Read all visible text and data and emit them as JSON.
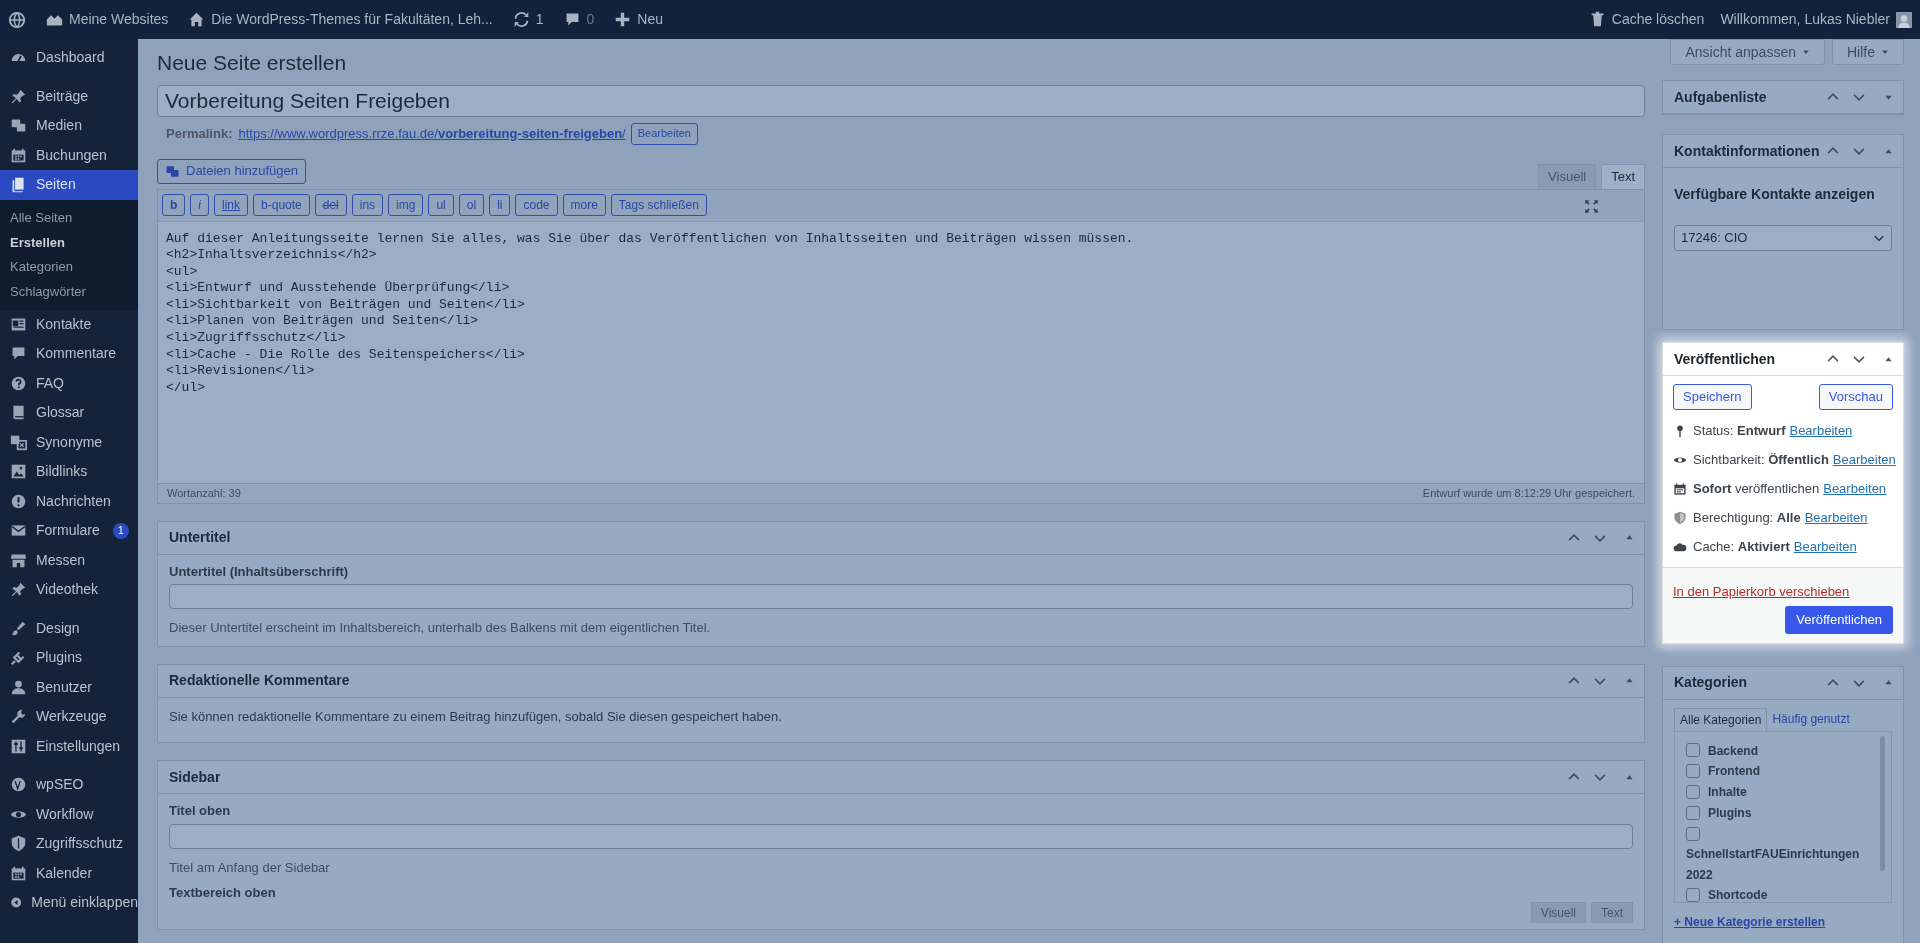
{
  "admin_bar": {
    "site_menu": "Meine Websites",
    "site_name": "Die WordPress-Themes für Fakultäten, Leh...",
    "updates": "1",
    "comments": "0",
    "new": "Neu",
    "cache": "Cache löschen",
    "greeting": "Willkommen, Lukas Niebler"
  },
  "sidebar": {
    "groups": [
      {
        "items": [
          {
            "label": "Dashboard",
            "selected": false
          }
        ]
      },
      {
        "items": [
          {
            "label": "Beiträge",
            "selected": false
          },
          {
            "label": "Medien",
            "selected": false
          },
          {
            "label": "Buchungen",
            "selected": false
          },
          {
            "label": "Seiten",
            "selected": true,
            "children": [
              {
                "label": "Alle Seiten",
                "selected": false
              },
              {
                "label": "Erstellen",
                "selected": true
              },
              {
                "label": "Kategorien",
                "selected": false
              },
              {
                "label": "Schlagwörter",
                "selected": false
              }
            ]
          },
          {
            "label": "Kontakte",
            "selected": false
          },
          {
            "label": "Kommentare",
            "selected": false
          },
          {
            "label": "FAQ",
            "selected": false
          },
          {
            "label": "Glossar",
            "selected": false
          },
          {
            "label": "Synonyme",
            "selected": false
          },
          {
            "label": "Bildlinks",
            "selected": false
          },
          {
            "label": "Nachrichten",
            "selected": false
          },
          {
            "label": "Formulare",
            "selected": false,
            "badge": "1"
          },
          {
            "label": "Messen",
            "selected": false
          },
          {
            "label": "Videothek",
            "selected": false
          }
        ]
      },
      {
        "items": [
          {
            "label": "Design",
            "selected": false
          },
          {
            "label": "Plugins",
            "selected": false
          },
          {
            "label": "Benutzer",
            "selected": false
          },
          {
            "label": "Werkzeuge",
            "selected": false
          },
          {
            "label": "Einstellungen",
            "selected": false
          }
        ]
      },
      {
        "items": [
          {
            "label": "wpSEO",
            "selected": false
          },
          {
            "label": "Workflow",
            "selected": false
          },
          {
            "label": "Zugriffsschutz",
            "selected": false
          },
          {
            "label": "Kalender",
            "selected": false
          },
          {
            "label": "Menü einklappen",
            "selected": false
          }
        ]
      }
    ]
  },
  "page_title": "Neue Seite erstellen",
  "screen_buttons": [
    "Ansicht anpassen",
    "Hilfe"
  ],
  "post_title": "Vorbereitung Seiten Freigeben",
  "permalink": {
    "label": "Permalink:",
    "base": "https://www.wordpress.rrze.fau.de/",
    "slug": "vorbereitung-seiten-freigeben",
    "trailing": "/",
    "edit": "Bearbeiten"
  },
  "media_button": "Dateien hinzufügen",
  "editor_tabs": [
    {
      "label": "Visuell",
      "selected": false
    },
    {
      "label": "Text",
      "selected": true
    }
  ],
  "quicktags": [
    "b",
    "i",
    "link",
    "b-quote",
    "del",
    "ins",
    "img",
    "ul",
    "ol",
    "li",
    "code",
    "more",
    "Tags schließen"
  ],
  "content_lines": [
    "Auf dieser Anleitungsseite lernen Sie alles, was Sie über das Veröffentlichen von Inhaltsseiten und Beiträgen wissen müssen.",
    "<h2>Inhaltsverzeichnis</h2>",
    "<ul>",
    "<li>Entwurf und Ausstehende Überprüfung</li>",
    "<li>Sichtbarkeit von Beiträgen und Seiten</li>",
    "<li>Planen von Beiträgen und Seiten</li>",
    "<li>Zugriffsschutz</li>",
    "<li>Cache - Die Rolle des Seitenspeichers</li>",
    "<li>Revisionen</li>",
    "</ul>"
  ],
  "word_count": "Wortanzahl: 39",
  "autosave": "Entwurf wurde um 8:12:29 Uhr gespeichert.",
  "main_boxes": [
    {
      "title": "Untertitel",
      "content": [
        {
          "kind": "label",
          "text": "Untertitel (Inhaltsüberschrift)"
        },
        {
          "kind": "input"
        },
        {
          "kind": "help",
          "text": "Dieser Untertitel erscheint im Inhaltsbereich, unterhalb des Balkens mit dem eigentlichen Titel."
        }
      ]
    },
    {
      "title": "Redaktionelle Kommentare",
      "content": [
        {
          "kind": "text",
          "text": "Sie können redaktionelle Kommentare zu einem Beitrag hinzufügen, sobald Sie diesen gespeichert haben."
        }
      ]
    },
    {
      "title": "Sidebar",
      "content": [
        {
          "kind": "label",
          "text": "Titel oben"
        },
        {
          "kind": "input"
        },
        {
          "kind": "help",
          "text": "Titel am Anfang der Sidebar"
        },
        {
          "kind": "label",
          "text": "Textbereich oben"
        },
        {
          "kind": "tabs",
          "tabs": [
            {
              "label": "Visuell",
              "selected": false
            },
            {
              "label": "Text",
              "selected": false
            }
          ]
        }
      ]
    }
  ],
  "side_boxes": [
    {
      "kind": "plain",
      "title": "Aufgabenliste",
      "expanded": false
    },
    {
      "kind": "contacts",
      "title": "Kontaktinformationen",
      "expanded": true,
      "heading": "Verfügbare Kontakte anzeigen",
      "select": "17246: CIO"
    },
    {
      "kind": "publish",
      "title": "Veröffentlichen",
      "expanded": true,
      "save": "Speichern",
      "preview": "Vorschau",
      "rows": [
        {
          "text": "Status: **Entwurf**",
          "edit": "Bearbeiten"
        },
        {
          "text": "Sichtbarkeit: **Öffentlich**",
          "edit": "Bearbeiten"
        },
        {
          "text": "**Sofort** veröffentlichen",
          "edit": "Bearbeiten"
        },
        {
          "text": "Berechtigung: **Alle**",
          "edit": "Bearbeiten"
        },
        {
          "text": "Cache: **Aktiviert**",
          "edit": "Bearbeiten"
        }
      ],
      "trash": "In den Papierkorb verschieben",
      "publish": "Veröffentlichen"
    },
    {
      "kind": "categories",
      "title": "Kategorien",
      "expanded": true,
      "tabs": [
        {
          "label": "Alle Kategorien",
          "selected": true
        },
        {
          "label": "Häufig genutzt",
          "selected": false
        }
      ],
      "items": [
        {
          "label": "Backend",
          "checked": false
        },
        {
          "label": "Frontend",
          "checked": false
        },
        {
          "label": "Inhalte",
          "checked": false
        },
        {
          "label": "Plugins",
          "checked": false
        },
        {
          "label": "SchnellstartFAUEinrichtungen2022",
          "checked": false
        },
        {
          "label": "Shortcode",
          "checked": false
        }
      ],
      "add": "+ Neue Kategorie erstellen"
    }
  ]
}
